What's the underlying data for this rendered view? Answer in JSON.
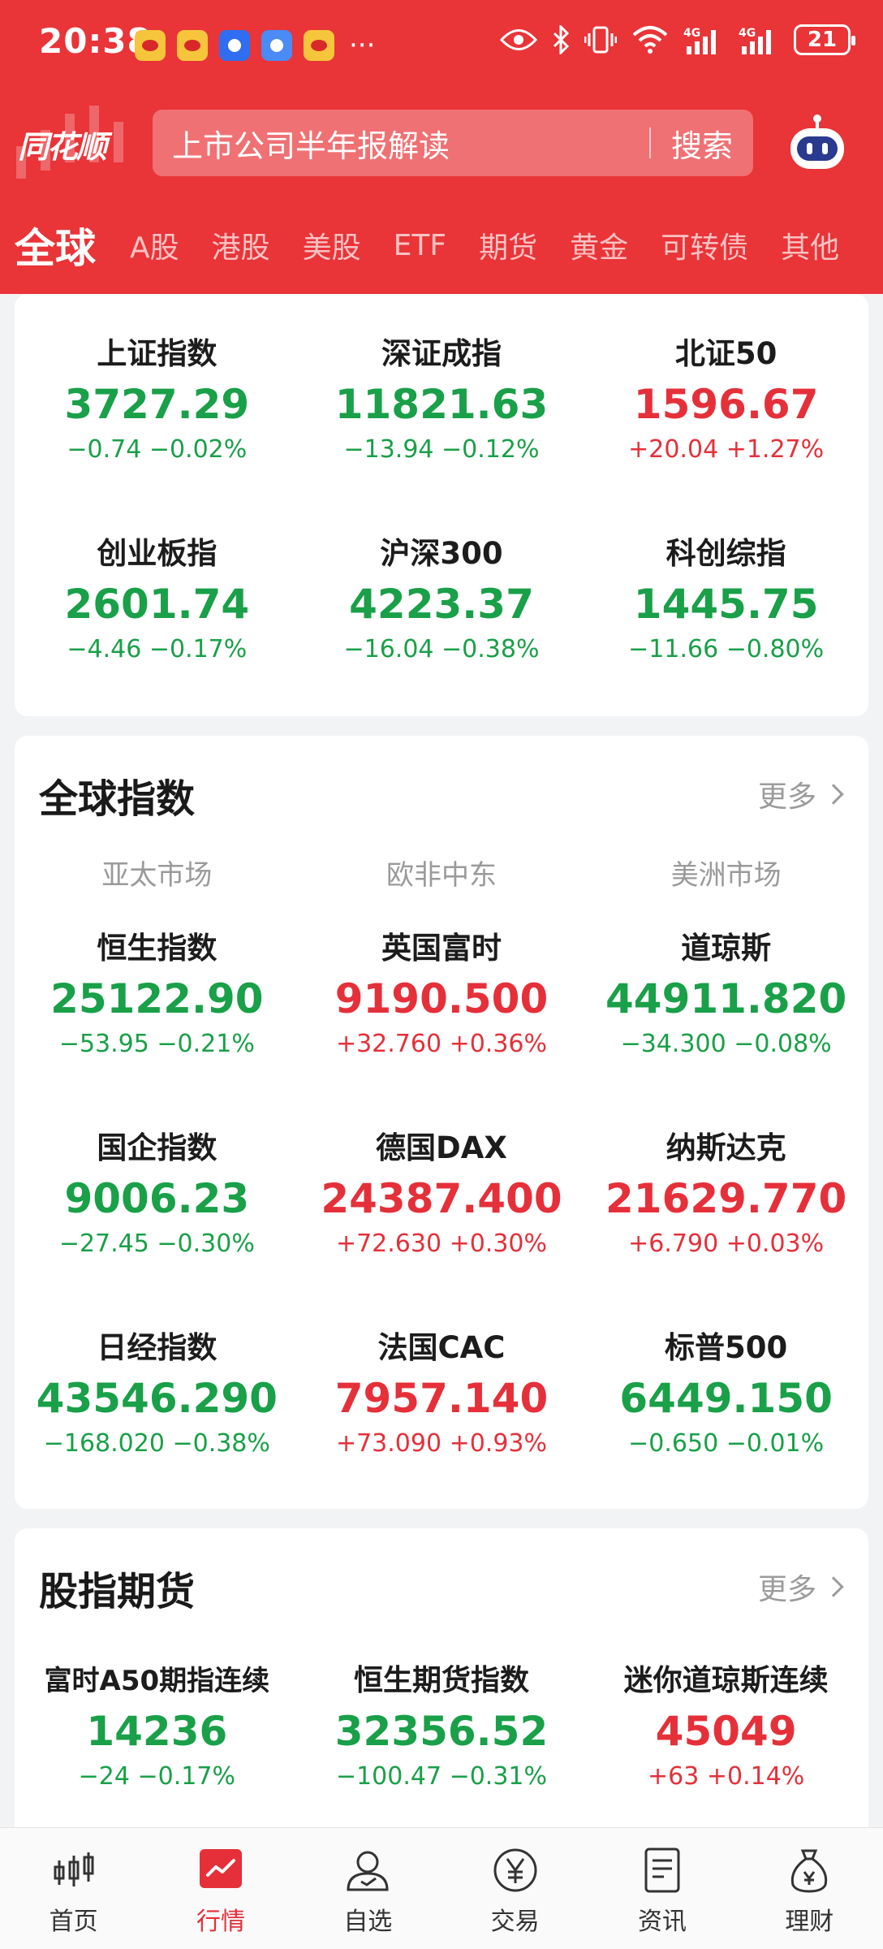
{
  "status_bar": {
    "time": "20:38",
    "battery": "21",
    "more": "···"
  },
  "header": {
    "logo": "同花顺",
    "search_placeholder": "上市公司半年报解读",
    "search_button": "搜索"
  },
  "tabs": [
    "全球",
    "A股",
    "港股",
    "美股",
    "ETF",
    "期货",
    "黄金",
    "可转债",
    "其他"
  ],
  "a_indices": [
    {
      "name": "上证指数",
      "price": "3727.29",
      "change": "−0.74  −0.02%",
      "trend": "down"
    },
    {
      "name": "深证成指",
      "price": "11821.63",
      "change": "−13.94  −0.12%",
      "trend": "down"
    },
    {
      "name": "北证50",
      "price": "1596.67",
      "change": "+20.04  +1.27%",
      "trend": "up"
    },
    {
      "name": "创业板指",
      "price": "2601.74",
      "change": "−4.46  −0.17%",
      "trend": "down"
    },
    {
      "name": "沪深300",
      "price": "4223.37",
      "change": "−16.04  −0.38%",
      "trend": "down"
    },
    {
      "name": "科创综指",
      "price": "1445.75",
      "change": "−11.66  −0.80%",
      "trend": "down"
    }
  ],
  "global": {
    "title": "全球指数",
    "more": "更多",
    "regions": [
      "亚太市场",
      "欧非中东",
      "美洲市场"
    ],
    "items": [
      {
        "name": "恒生指数",
        "price": "25122.90",
        "change": "−53.95  −0.21%",
        "trend": "down"
      },
      {
        "name": "英国富时",
        "price": "9190.500",
        "change": "+32.760  +0.36%",
        "trend": "up"
      },
      {
        "name": "道琼斯",
        "price": "44911.820",
        "change": "−34.300  −0.08%",
        "trend": "down"
      },
      {
        "name": "国企指数",
        "price": "9006.23",
        "change": "−27.45  −0.30%",
        "trend": "down"
      },
      {
        "name": "德国DAX",
        "price": "24387.400",
        "change": "+72.630  +0.30%",
        "trend": "up"
      },
      {
        "name": "纳斯达克",
        "price": "21629.770",
        "change": "+6.790  +0.03%",
        "trend": "up"
      },
      {
        "name": "日经指数",
        "price": "43546.290",
        "change": "−168.020  −0.38%",
        "trend": "down"
      },
      {
        "name": "法国CAC",
        "price": "7957.140",
        "change": "+73.090  +0.93%",
        "trend": "up"
      },
      {
        "name": "标普500",
        "price": "6449.150",
        "change": "−0.650  −0.01%",
        "trend": "down"
      }
    ]
  },
  "futures": {
    "title": "股指期货",
    "more": "更多",
    "items": [
      {
        "name": "富时A50期指连续",
        "price": "14236",
        "change": "−24  −0.17%",
        "trend": "down"
      },
      {
        "name": "恒生期货指数",
        "price": "32356.52",
        "change": "−100.47  −0.31%",
        "trend": "down"
      },
      {
        "name": "迷你道琼斯连续",
        "price": "45049",
        "change": "+63  +0.14%",
        "trend": "up"
      }
    ]
  },
  "bottom_nav": [
    {
      "label": "首页",
      "icon": "candlestick-icon"
    },
    {
      "label": "行情",
      "icon": "market-chart-icon"
    },
    {
      "label": "自选",
      "icon": "person-icon"
    },
    {
      "label": "交易",
      "icon": "yen-icon"
    },
    {
      "label": "资讯",
      "icon": "news-icon"
    },
    {
      "label": "理财",
      "icon": "money-bag-icon"
    }
  ],
  "colors": {
    "brand": "#e93438",
    "up": "#e5303a",
    "down": "#19a048"
  }
}
